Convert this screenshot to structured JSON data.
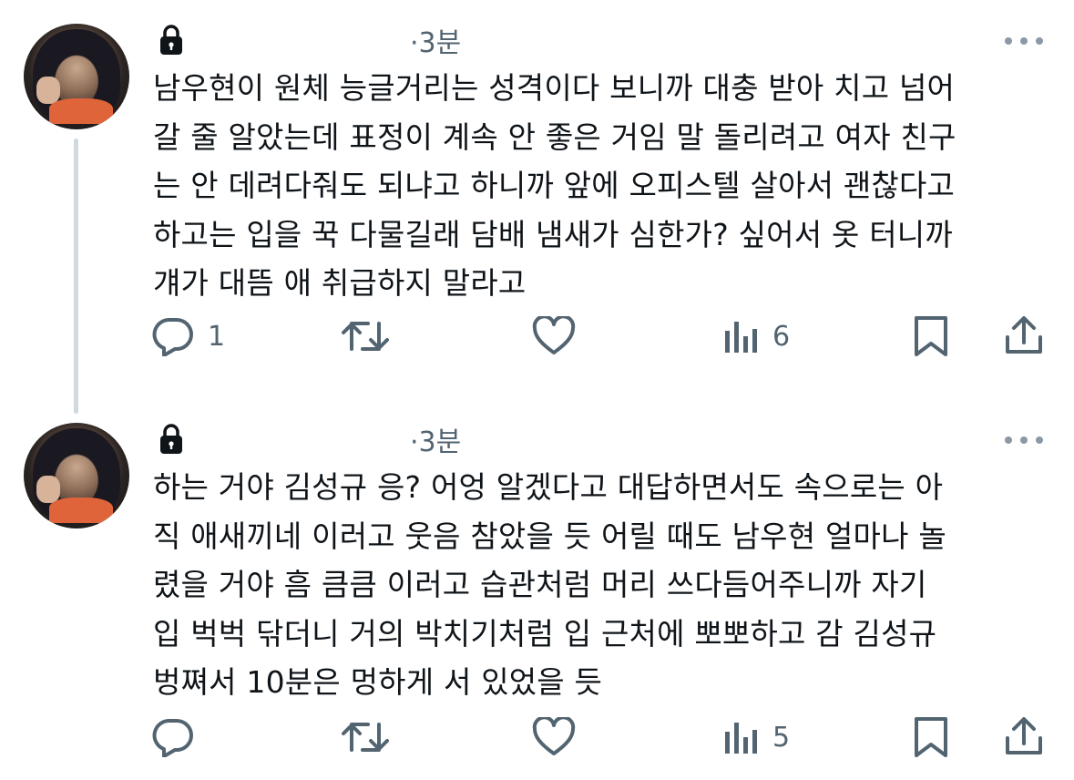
{
  "posts": [
    {
      "time": "·3분",
      "text": "남우현이 원체 능글거리는 성격이다 보니까 대충 받아 치고 넘어\n갈 줄 알았는데 표정이 계속 안 좋은 거임 말 돌리려고 여자 친구\n는 안 데려다줘도 되냐고 하니까 앞에 오피스텔 살아서 괜찮다고\n하고는 입을 꾹 다물길래 담배 냄새가 심한가? 싶어서 옷 터니까\n걔가 대뜸 애 취급하지 말라고",
      "replies": "1",
      "reposts": "",
      "likes": "",
      "views": "6"
    },
    {
      "time": "·3분",
      "text": "하는 거야 김성규 응? 어엉 알겠다고 대답하면서도 속으로는 아\n직 애새끼네 이러고 웃음 참았을 듯 어릴 때도 남우현 얼마나 놀\n렸을 거야 흠 큼큼 이러고 습관처럼 머리 쓰다듬어주니까 자기\n입 벅벅 닦더니 거의 박치기처럼 입 근처에 뽀뽀하고 감 김성규\n벙쪄서 10분은 멍하게 서 있었을 듯",
      "replies": "",
      "reposts": "",
      "likes": "",
      "views": "5"
    }
  ],
  "icons": {
    "lock": "lock-icon",
    "more": "more-icon",
    "reply": "reply-icon",
    "repost": "repost-icon",
    "like": "like-icon",
    "views": "views-icon",
    "bookmark": "bookmark-icon",
    "share": "share-icon"
  },
  "colors": {
    "text": "#0f1419",
    "secondary": "#536471",
    "thread_line": "#cfd9de"
  }
}
